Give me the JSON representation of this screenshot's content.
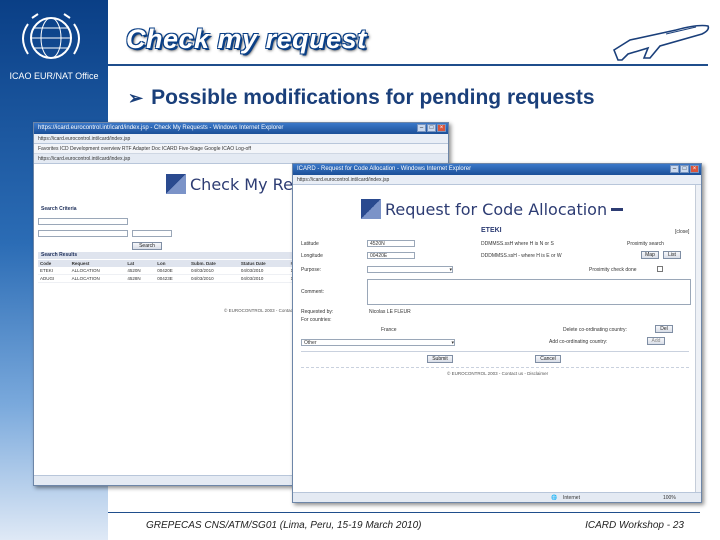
{
  "slide": {
    "title": "Check my request",
    "office": "ICAO EUR/NAT Office",
    "bullet": "Possible modifications for pending requests",
    "footer_left": "GREPECAS CNS/ATM/SG01 (Lima, Peru, 15-19 March 2010)",
    "footer_right": "ICARD Workshop - 23"
  },
  "window1": {
    "titlebar": "https://icard.eurocontrol.int/icard/index.jsp - Check My Requests - Windows Internet Explorer",
    "address": "https://icard.eurocontrol.int/icard/index.jsp",
    "favorites": "Favorites   ICD Development overview   RTF Adapter Doc   ICARD Five-Stage   Google   ICAO   Log-off",
    "tab": "https://icard.eurocontrol.int/icard/index.jsp",
    "heading": "Check My Requests",
    "search_section": "Search Criteria",
    "search_button": "Search",
    "results_section": "Search Results",
    "columns": [
      "Code",
      "Request",
      "Lat",
      "Lon",
      "Subm. Date",
      "Status Date",
      "#"
    ],
    "rows": [
      [
        "ETEKI",
        "ALLOCATION",
        "4520N",
        "00420E",
        "04/03/2010",
        "04/03/2010",
        "1"
      ],
      [
        "ADUGI",
        "ALLOCATION",
        "4528N",
        "00423E",
        "04/03/2010",
        "04/03/2010",
        "1"
      ]
    ],
    "page_footer": "© EUROCONTROL 2003 - Contact us - Disclaimer"
  },
  "window2": {
    "titlebar": "ICARD - Request for Code Allocation - Windows Internet Explorer",
    "address": "https://icard.eurocontrol.int/icard/index.jsp",
    "heading": "Request for Code Allocation",
    "code": "ETEKI",
    "close_link": "[close]",
    "latitude_label": "Latitude",
    "latitude_value": "4520N",
    "longitude_label": "Longitude",
    "longitude_value": "00420E",
    "lat_format": "DDMMSS.ssH where H is N or S",
    "lon_format": "DDDMMSS.ssH - where H is E or W",
    "proximity_search": "Proximity search",
    "map_button": "Map",
    "list_button": "List",
    "purpose_label": "Purpose:",
    "proximity_check": "Proximity check done",
    "comment_label": "Comment:",
    "requested_by_label": "Requested by:",
    "requested_by_value": "Nicolas LE FLEUR",
    "for_countries_label": "For countries:",
    "country": "France",
    "delete_label": "Delete co-ordinating country:",
    "delete_button": "Del",
    "add_label": "Add co-ordinating country:",
    "add_button": "Add",
    "other_select": "Other",
    "submit_button": "Submit",
    "cancel_button": "Cancel",
    "page_footer": "© EUROCONTROL 2003 - Contact us - Disclaimer",
    "status_zone": "Internet",
    "zoom": "100%"
  },
  "colors": {
    "accent": "#1a3f7a",
    "sidebar_top": "#0a3f86",
    "heading": "#2d3c73"
  }
}
